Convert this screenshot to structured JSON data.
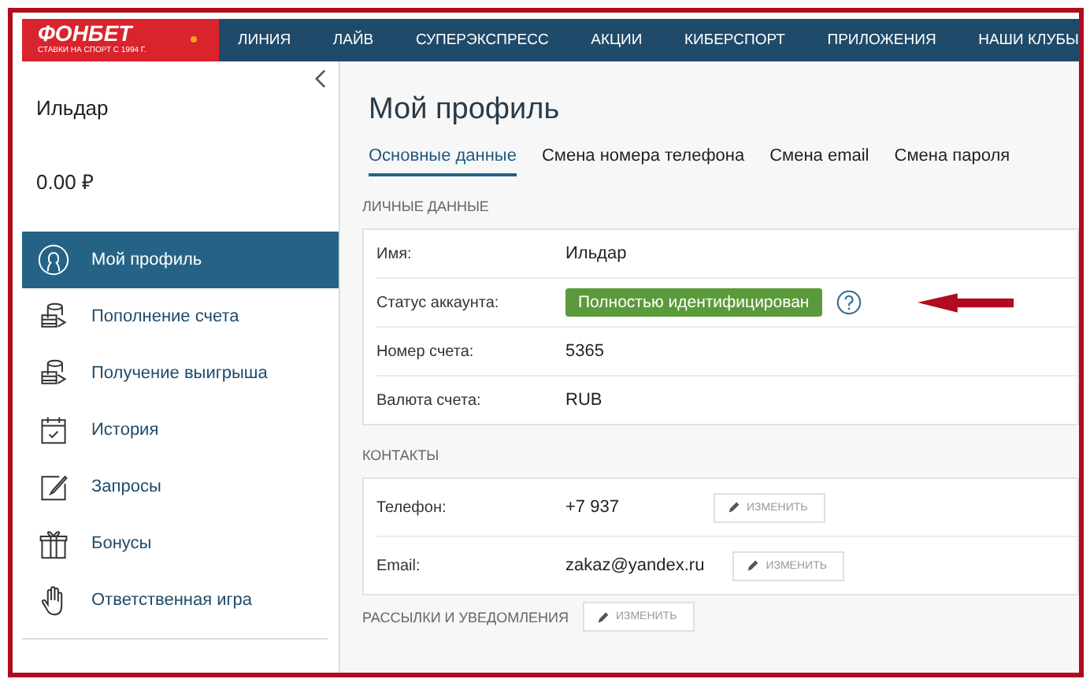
{
  "logo": {
    "name": "ФОНБЕТ",
    "tagline": "СТАВКИ НА СПОРТ С 1994 Г."
  },
  "nav": [
    "ЛИНИЯ",
    "ЛАЙВ",
    "СУПЕРЭКСПРЕСС",
    "АКЦИИ",
    "КИБЕРСПОРТ",
    "ПРИЛОЖЕНИЯ",
    "НАШИ КЛУБЫ"
  ],
  "sidebar": {
    "user_name": "Ильдар",
    "balance": "0.00 ₽",
    "items": [
      {
        "label": "Мой профиль",
        "selected": true
      },
      {
        "label": "Пополнение счета",
        "selected": false
      },
      {
        "label": "Получение выигрыша",
        "selected": false
      },
      {
        "label": "История",
        "selected": false
      },
      {
        "label": "Запросы",
        "selected": false
      },
      {
        "label": "Бонусы",
        "selected": false
      },
      {
        "label": "Ответственная игра",
        "selected": false
      }
    ]
  },
  "profile": {
    "title": "Мой профиль",
    "tabs": [
      {
        "label": "Основные данные",
        "selected": true
      },
      {
        "label": "Смена номера телефона",
        "selected": false
      },
      {
        "label": "Смена email",
        "selected": false
      },
      {
        "label": "Смена пароля",
        "selected": false
      }
    ],
    "personal": {
      "heading": "ЛИЧНЫЕ ДАННЫЕ",
      "rows": [
        {
          "kind": "text",
          "label": "Имя:",
          "value": "Ильдар"
        },
        {
          "kind": "badge",
          "label": "Статус аккаунта:",
          "value": "Полностью идентифицирован"
        },
        {
          "kind": "text",
          "label": "Номер счета:",
          "value": "5365"
        },
        {
          "kind": "text",
          "label": "Валюта счета:",
          "value": "RUB"
        }
      ]
    },
    "contacts": {
      "heading": "КОНТАКТЫ",
      "rows": [
        {
          "label": "Телефон:",
          "value": "+7 937",
          "action": "ИЗМЕНИТЬ"
        },
        {
          "label": "Email:",
          "value": "zakaz@yandex.ru",
          "action": "ИЗМЕНИТЬ"
        }
      ]
    },
    "notifications": {
      "heading": "РАССЫЛКИ И УВЕДОМЛЕНИЯ",
      "action": "ИЗМЕНИТЬ"
    }
  }
}
